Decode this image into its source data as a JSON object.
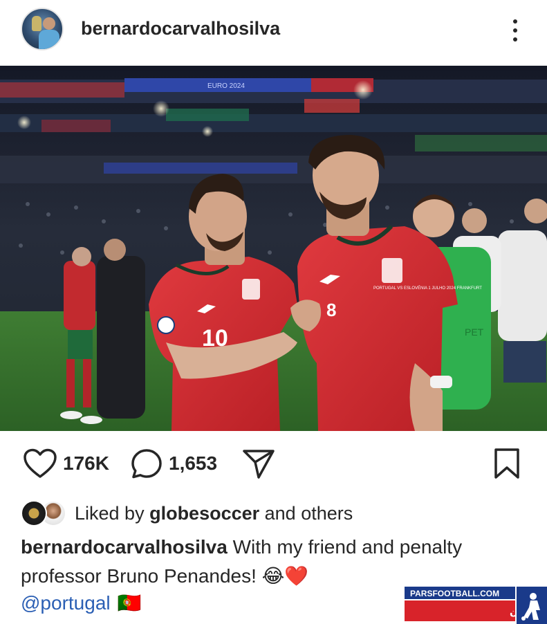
{
  "post": {
    "username": "bernardocarvalhosilva",
    "photo_alt": ""
  },
  "actions": {
    "likes": "176K",
    "comments": "1,653"
  },
  "liked_by": {
    "prefix": "Liked by ",
    "name": "globesoccer",
    "suffix": " and others"
  },
  "caption": {
    "author": "bernardocarvalhosilva",
    "text": " With my friend and penalty professor Bruno Penandes! ",
    "emojis": "😂❤️",
    "mention": "@portugal",
    "flag": "🇵🇹"
  },
  "photo": {
    "shirt_left_number": "10",
    "shirt_right_number": "8",
    "banner_text": "EURO 2024",
    "kit_text": "PORTUGAL VS ESLOVÉNIA 1 JULHO 2024 FRANKFURT"
  },
  "watermark": {
    "site": "PARSFOOTBALL.COM",
    "tagline": "خبرگزاری فوتبال ایران"
  },
  "colors": {
    "text": "#262626",
    "mention": "#2b5fb4",
    "shirt_red": "#d32a2f",
    "watermark_bg": "#1a3a8a",
    "watermark_red": "#d8232a"
  },
  "icons": {
    "like": "heart-icon",
    "comment": "comment-icon",
    "share": "paper-plane-icon",
    "save": "bookmark-icon",
    "more": "more-vertical-icon"
  }
}
